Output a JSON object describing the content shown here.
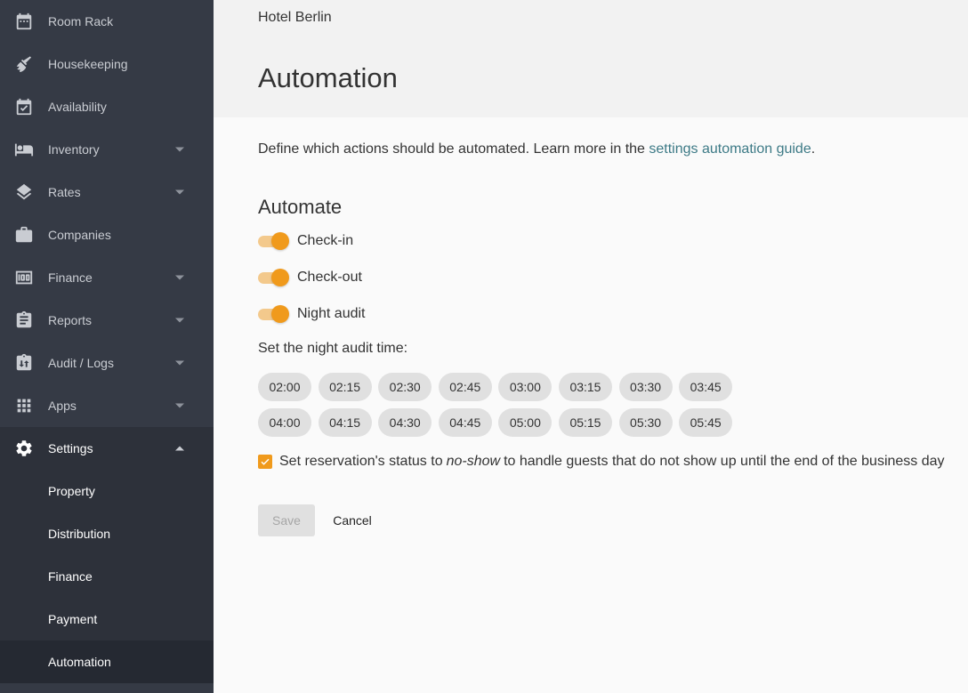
{
  "sidebar": {
    "items": [
      {
        "label": "Room Rack",
        "icon": "calendar-icon"
      },
      {
        "label": "Housekeeping",
        "icon": "broom-icon"
      },
      {
        "label": "Availability",
        "icon": "calendar-check-icon"
      },
      {
        "label": "Inventory",
        "icon": "bed-icon",
        "expandable": true
      },
      {
        "label": "Rates",
        "icon": "layers-icon",
        "expandable": true
      },
      {
        "label": "Companies",
        "icon": "briefcase-icon"
      },
      {
        "label": "Finance",
        "icon": "money-icon",
        "expandable": true
      },
      {
        "label": "Reports",
        "icon": "clipboard-icon",
        "expandable": true
      },
      {
        "label": "Audit / Logs",
        "icon": "audit-icon",
        "expandable": true
      },
      {
        "label": "Apps",
        "icon": "apps-grid-icon",
        "expandable": true
      },
      {
        "label": "Settings",
        "icon": "gear-icon",
        "expanded": true
      }
    ],
    "settings_sub": [
      {
        "label": "Property"
      },
      {
        "label": "Distribution"
      },
      {
        "label": "Finance"
      },
      {
        "label": "Payment"
      },
      {
        "label": "Automation",
        "active": true
      }
    ]
  },
  "header": {
    "hotel_name": "Hotel Berlin",
    "title": "Automation"
  },
  "intro": {
    "text": "Define which actions should be automated. Learn more in the ",
    "link_text": "settings automation guide",
    "suffix": "."
  },
  "automate": {
    "title": "Automate",
    "toggles": [
      {
        "label": "Check-in",
        "on": true
      },
      {
        "label": "Check-out",
        "on": true
      },
      {
        "label": "Night audit",
        "on": true
      }
    ]
  },
  "night_audit": {
    "label": "Set the night audit time:",
    "times_row1": [
      "02:00",
      "02:15",
      "02:30",
      "02:45",
      "03:00",
      "03:15",
      "03:30",
      "03:45"
    ],
    "times_row2": [
      "04:00",
      "04:15",
      "04:30",
      "04:45",
      "05:00",
      "05:15",
      "05:30",
      "05:45"
    ]
  },
  "no_show": {
    "checked": true,
    "prefix": "Set reservation's status to",
    "emphasis": "no-show",
    "suffix": "to handle guests that do not show up until the end of the business day"
  },
  "actions": {
    "save_label": "Save",
    "cancel_label": "Cancel"
  },
  "colors": {
    "sidebar_bg": "#353a45",
    "accent": "#f09a1c",
    "link": "#3d7a86"
  }
}
